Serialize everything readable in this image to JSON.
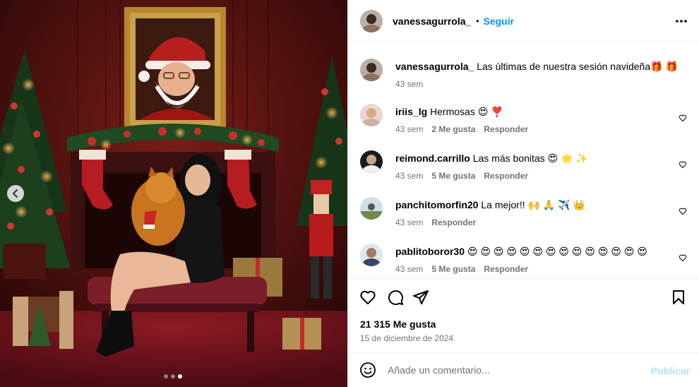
{
  "post": {
    "author": "vanessagurrola_",
    "bullet": "•",
    "follow_label": "Seguir",
    "caption": "Las últimas de nuestra sesión navideña🎁 🎁",
    "caption_time": "43 sem",
    "likes_text": "21 315 Me gusta",
    "date_text": "15 de diciembre de 2024"
  },
  "comments": [
    {
      "user": "iriis_lg",
      "text": "Hermosas 😍 ❣️",
      "time": "43 sem",
      "likes": "2 Me gusta",
      "reply": "Responder"
    },
    {
      "user": "reimond.carrillo",
      "text": "Las más bonitas 😍 🌟 ✨",
      "time": "43 sem",
      "likes": "5 Me gusta",
      "reply": "Responder"
    },
    {
      "user": "panchitomorfin20",
      "text": "La mejor!! 🙌 🙏 ✈️ 👑",
      "time": "43 sem",
      "likes": "",
      "reply": "Responder"
    },
    {
      "user": "pablitoboror30",
      "text": "😍 😍 😍 😍 😍 😍 😍 😍 😍 😍 😍 😍 😍 😍",
      "time": "43 sem",
      "likes": "5 Me gusta",
      "reply": "Responder"
    }
  ],
  "add_comment": {
    "placeholder": "Añade un comentario...",
    "publish_label": "Publicar"
  },
  "carousel": {
    "total": 3,
    "active_index": 3
  },
  "icons": {
    "more": "more-horizontal-icon",
    "like": "heart-outline-icon",
    "comment": "comment-bubble-icon",
    "share": "paper-plane-icon",
    "save": "bookmark-icon",
    "emoji": "smiley-icon",
    "prev": "chevron-left-icon"
  },
  "colors": {
    "accent": "#0095f6",
    "publish_disabled": "#b2dffc",
    "secondary_text": "#737373",
    "divider": "#efefef"
  }
}
